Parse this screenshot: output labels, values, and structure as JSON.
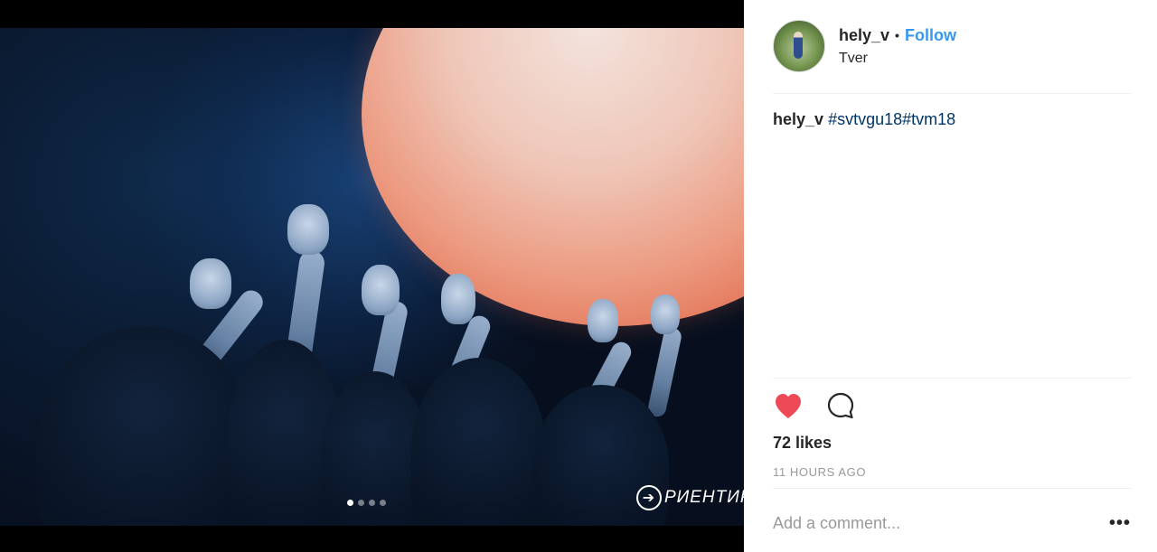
{
  "post": {
    "username": "hely_v",
    "separator": "•",
    "follow_label": "Follow",
    "location": "Tver",
    "caption_user": "hely_v",
    "caption_tags": "#svtvgu18#tvm18",
    "likes": "72 likes",
    "timestamp": "11 HOURS AGO",
    "comment_placeholder": "Add a comment...",
    "more_label": "•••",
    "carousel": {
      "total": 4,
      "active": 1
    },
    "watermark_text": "РИЕНТИР",
    "watermark_arrow": "➔"
  },
  "colors": {
    "accent": "#3897f0",
    "hashtag": "#003569",
    "heart": "#ed4956",
    "muted": "#999999"
  },
  "icons": [
    "heart-icon",
    "comment-icon",
    "more-options-icon"
  ]
}
